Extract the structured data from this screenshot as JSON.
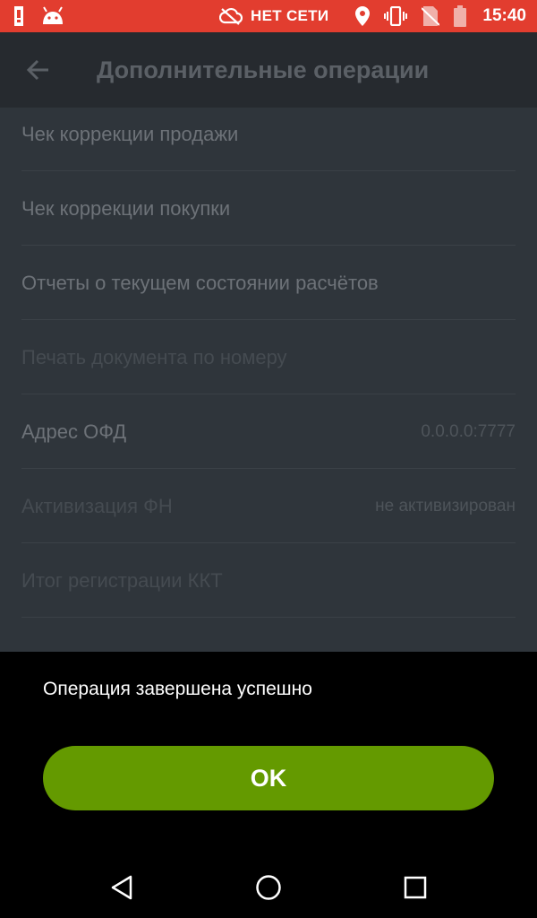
{
  "status_bar": {
    "network_label": "НЕТ СЕТИ",
    "time": "15:40",
    "icons": [
      "alert-icon",
      "android-icon",
      "cloud-off-icon",
      "location-icon",
      "vibrate-icon",
      "no-sim-icon",
      "battery-icon"
    ],
    "color": "#e23d2f"
  },
  "app_bar": {
    "title": "Дополнительные операции",
    "back_icon": "arrow-back-icon"
  },
  "list": {
    "items": [
      {
        "label": "Чек коррекции продажи",
        "value": "",
        "enabled": true
      },
      {
        "label": "Чек коррекции покупки",
        "value": "",
        "enabled": true
      },
      {
        "label": "Отчеты о текущем состоянии расчётов",
        "value": "",
        "enabled": true
      },
      {
        "label": "Печать документа по номеру",
        "value": "",
        "enabled": false
      },
      {
        "label": "Адрес ОФД",
        "value": "0.0.0.0:7777",
        "enabled": true
      },
      {
        "label": "Активизация ФН",
        "value": "не активизирован",
        "enabled": false
      },
      {
        "label": "Итог регистрации ККТ",
        "value": "",
        "enabled": false
      }
    ]
  },
  "dialog": {
    "message": "Операция завершена успешно",
    "ok_label": "OK",
    "ok_color": "#649a00"
  },
  "nav_bar": {
    "icons": [
      "back-triangle-icon",
      "home-circle-icon",
      "recents-square-icon"
    ]
  }
}
